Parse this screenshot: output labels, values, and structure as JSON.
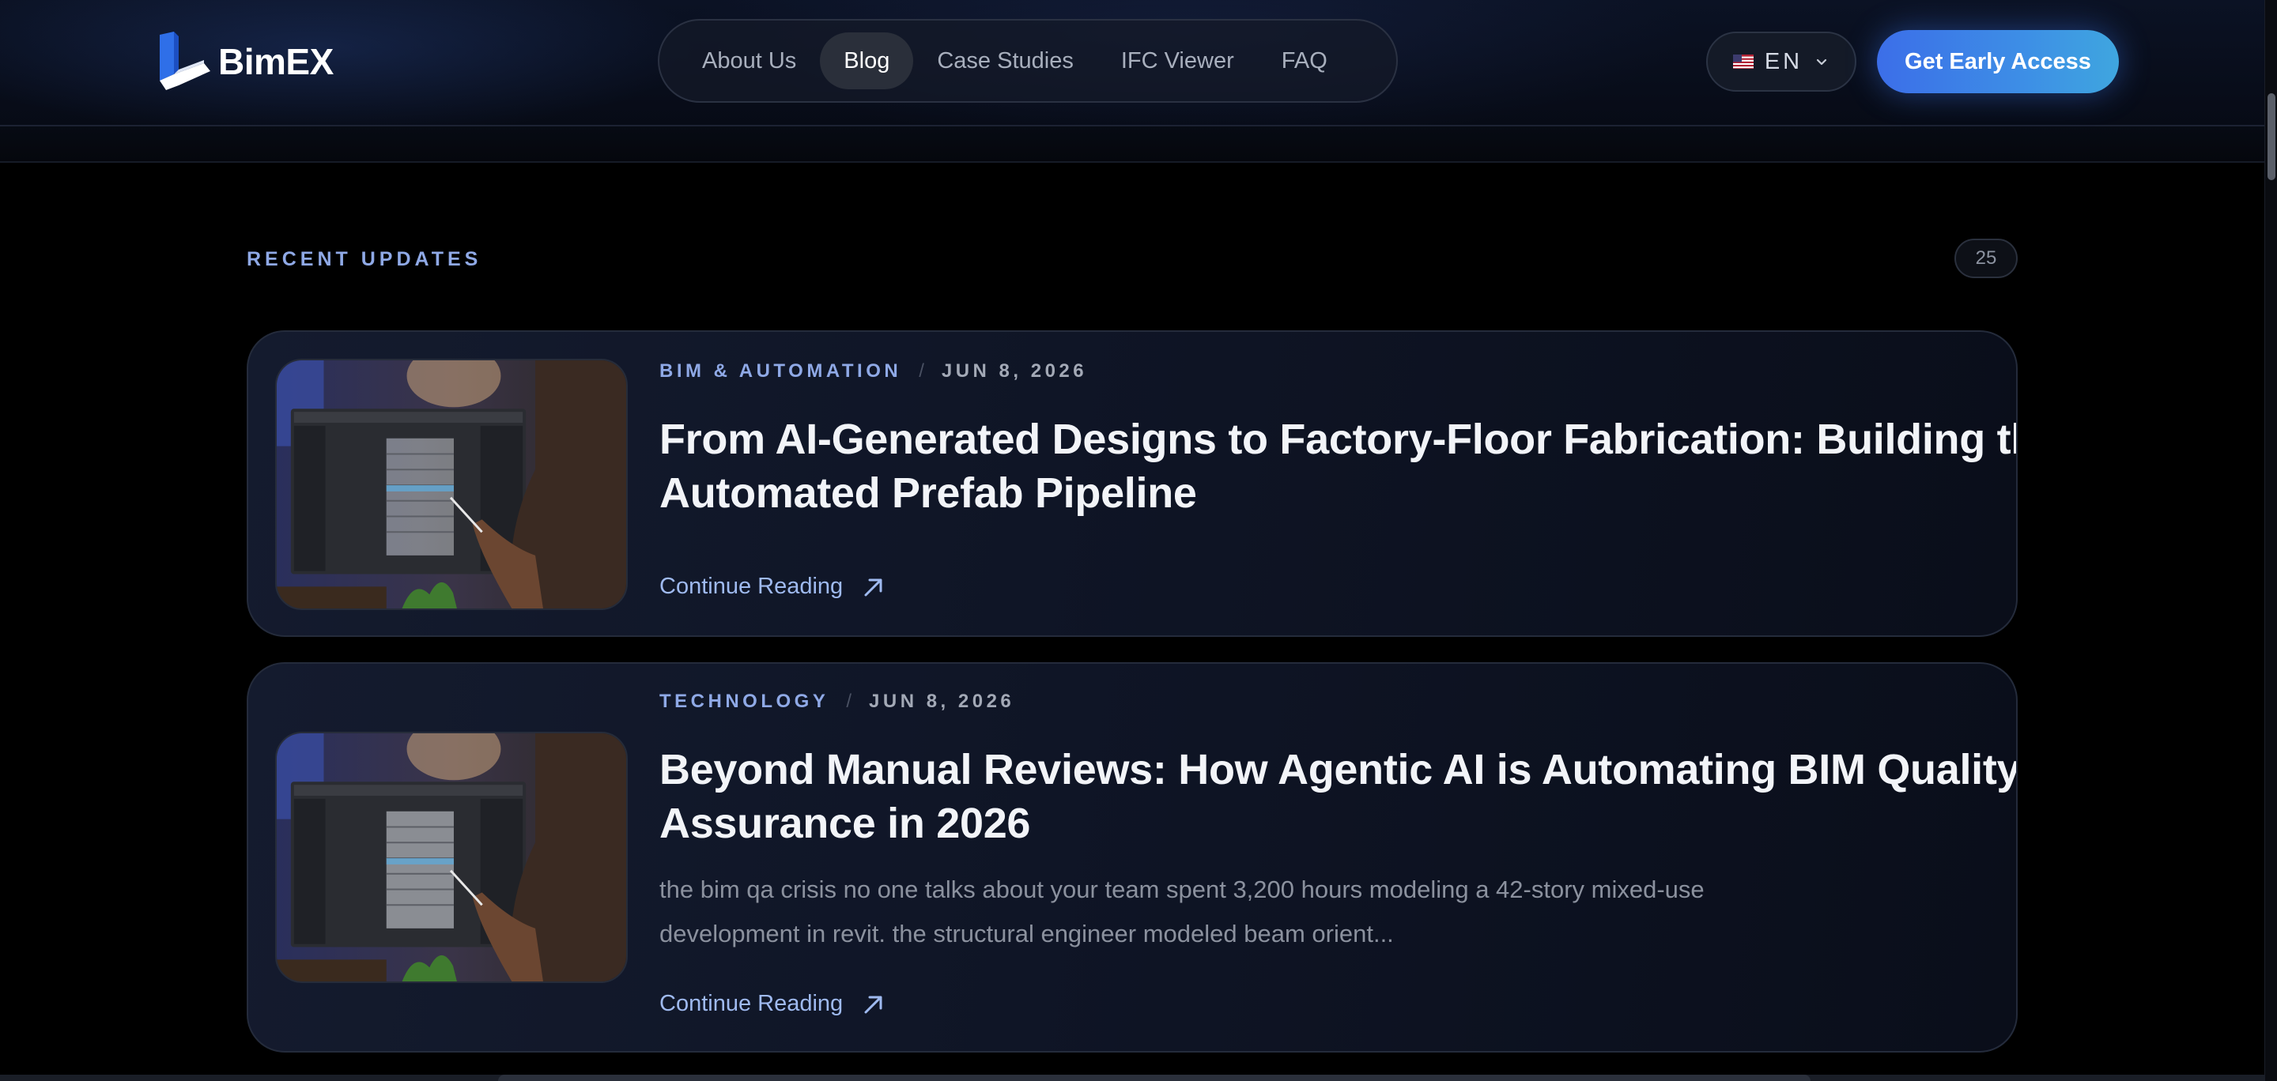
{
  "brand": {
    "name": "BimEX"
  },
  "nav": {
    "items": [
      {
        "label": "About Us",
        "active": false
      },
      {
        "label": "Blog",
        "active": true
      },
      {
        "label": "Case Studies",
        "active": false
      },
      {
        "label": "IFC Viewer",
        "active": false
      },
      {
        "label": "FAQ",
        "active": false
      }
    ]
  },
  "header": {
    "language": {
      "code": "EN",
      "flag_icon": "us-flag-icon"
    },
    "cta_label": "Get Early Access"
  },
  "section": {
    "label": "RECENT UPDATES",
    "count": "25"
  },
  "posts": [
    {
      "category": "BIM & AUTOMATION",
      "separator": "/",
      "date": "JUN 8, 2026",
      "title": "From AI-Generated Designs to Factory-Floor Fabrication: Building the Automated Prefab Pipeline",
      "excerpt": "",
      "read_more": "Continue Reading",
      "read_more_icon": "arrow-up-right-icon"
    },
    {
      "category": "TECHNOLOGY",
      "separator": "/",
      "date": "JUN 8, 2026",
      "title": "Beyond Manual Reviews: How Agentic AI is Automating BIM Quality Assurance in 2026",
      "excerpt": "the bim qa crisis no one talks about your team spent 3,200 hours modeling a 42-story mixed-use development in revit. the structural engineer modeled beam orient...",
      "read_more": "Continue Reading",
      "read_more_icon": "arrow-up-right-icon"
    }
  ],
  "colors": {
    "accent": "#8fa9e6",
    "cta_start": "#3c6ee8",
    "cta_end": "#3fa6df",
    "background": "#000000",
    "card": "#111729"
  }
}
